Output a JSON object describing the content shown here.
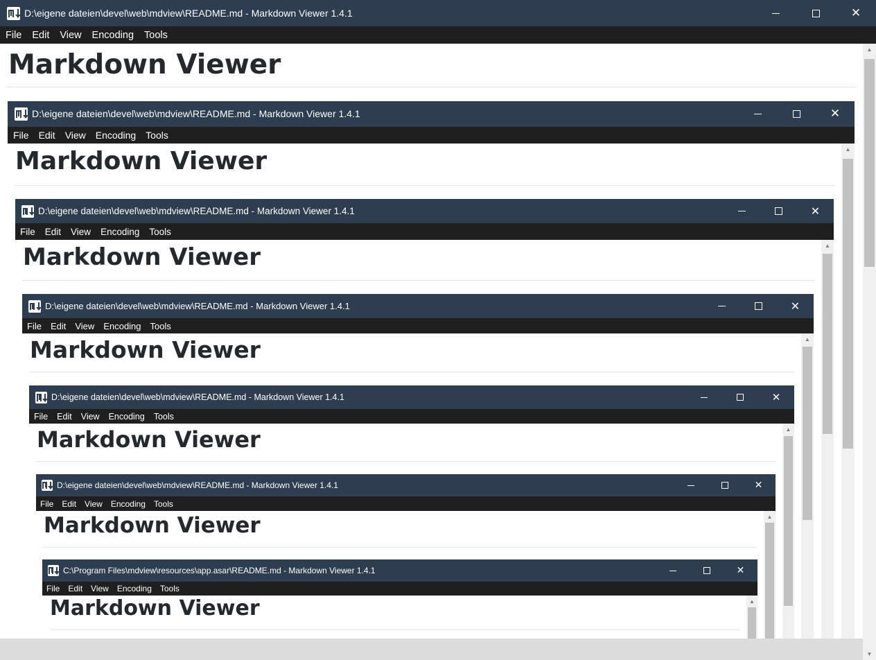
{
  "windows": [
    {
      "title": "D:\\eigene dateien\\devel\\web\\mdview\\README.md - Markdown Viewer 1.4.1",
      "heading": "Markdown Viewer"
    },
    {
      "title": "D:\\eigene dateien\\devel\\web\\mdview\\README.md - Markdown Viewer 1.4.1",
      "heading": "Markdown Viewer"
    },
    {
      "title": "D:\\eigene dateien\\devel\\web\\mdview\\README.md - Markdown Viewer 1.4.1",
      "heading": "Markdown Viewer"
    },
    {
      "title": "D:\\eigene dateien\\devel\\web\\mdview\\README.md - Markdown Viewer 1.4.1",
      "heading": "Markdown Viewer"
    },
    {
      "title": "D:\\eigene dateien\\devel\\web\\mdview\\README.md - Markdown Viewer 1.4.1",
      "heading": "Markdown Viewer"
    },
    {
      "title": "D:\\eigene dateien\\devel\\web\\mdview\\README.md - Markdown Viewer 1.4.1",
      "heading": "Markdown Viewer"
    },
    {
      "title": "C:\\Program Files\\mdview\\resources\\app.asar\\README.md - Markdown Viewer 1.4.1",
      "heading": "Markdown Viewer"
    }
  ],
  "menu": [
    "File",
    "Edit",
    "View",
    "Encoding",
    "Tools"
  ],
  "icons": {
    "app": "markdown-icon",
    "minimize": "minimize-icon",
    "maximize": "maximize-icon",
    "close": "close-icon"
  },
  "colors": {
    "titlebar": "#2e3d50",
    "menubar": "#1f1f1f",
    "heading": "#24292e"
  }
}
